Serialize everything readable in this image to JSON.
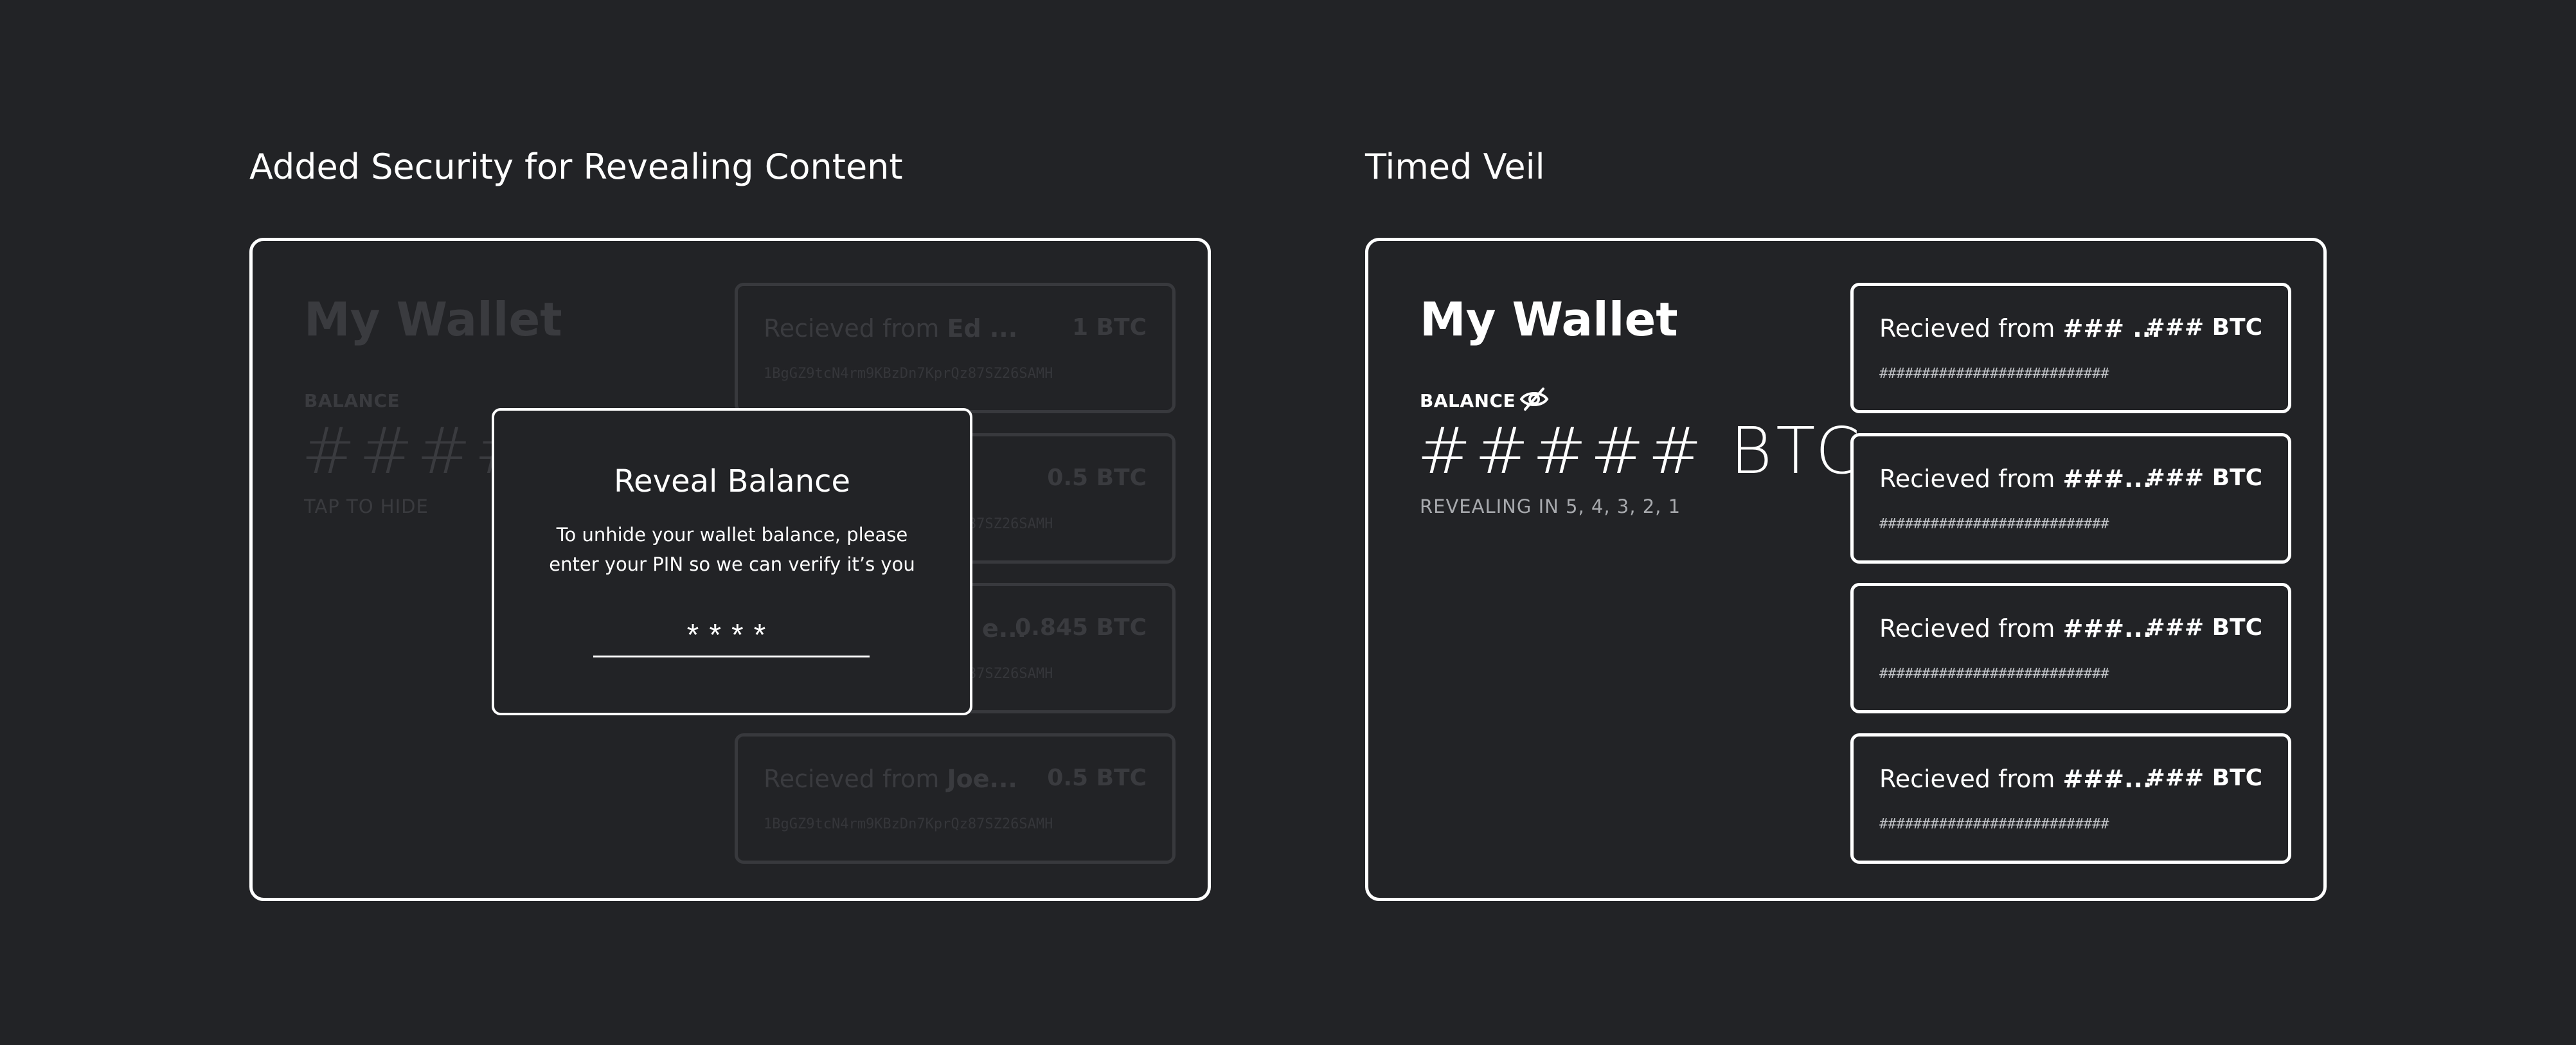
{
  "left_panel": {
    "title": "Added Security for Revealing Content",
    "wallet_title": "My Wallet",
    "balance_label": "BALANCE",
    "balance_value": "####",
    "balance_hint": "TAP TO HIDE",
    "transactions": [
      {
        "from_label": "Recieved from ",
        "from_name": "Ed ...",
        "amount": "1 BTC",
        "address": "1BgGZ9tcN4rm9KBzDn7KprQz87SZ26SAMH"
      },
      {
        "from_label": "",
        "from_name": "",
        "amount": "0.5 BTC",
        "address": "1BgGZ9tcN4rm9KBzDn7KprQz87SZ26SAMH"
      },
      {
        "from_label": "",
        "from_name": "e...",
        "amount": "0.845 BTC",
        "address": "1BgGZ9tcN4rm9KBzDn7KprQz87SZ26SAMH"
      },
      {
        "from_label": "Recieved from ",
        "from_name": "Joe...",
        "amount": "0.5 BTC",
        "address": "1BgGZ9tcN4rm9KBzDn7KprQz87SZ26SAMH"
      }
    ],
    "modal": {
      "title": "Reveal Balance",
      "body": "To unhide your wallet balance, please enter your PIN so we can verify it’s you",
      "pin_value": "****"
    }
  },
  "right_panel": {
    "title": "Timed Veil",
    "wallet_title": "My Wallet",
    "balance_label": "BALANCE",
    "balance_icon": "eye-off-icon",
    "balance_value": "##### BTC",
    "countdown": "REVEALING IN 5, 4, 3, 2, 1",
    "transactions": [
      {
        "from_label": "Recieved from ",
        "from_name": "### ...",
        "amount": "### BTC",
        "address": "###########################"
      },
      {
        "from_label": "Recieved from ",
        "from_name": "###...",
        "amount": "### BTC",
        "address": "###########################"
      },
      {
        "from_label": "Recieved from ",
        "from_name": "###...",
        "amount": "### BTC",
        "address": "###########################"
      },
      {
        "from_label": "Recieved from ",
        "from_name": "###...",
        "amount": "### BTC",
        "address": "###########################"
      }
    ]
  },
  "colors": {
    "background": "#222326",
    "foreground": "#ffffff",
    "dimmed": "#3a3b3f"
  }
}
